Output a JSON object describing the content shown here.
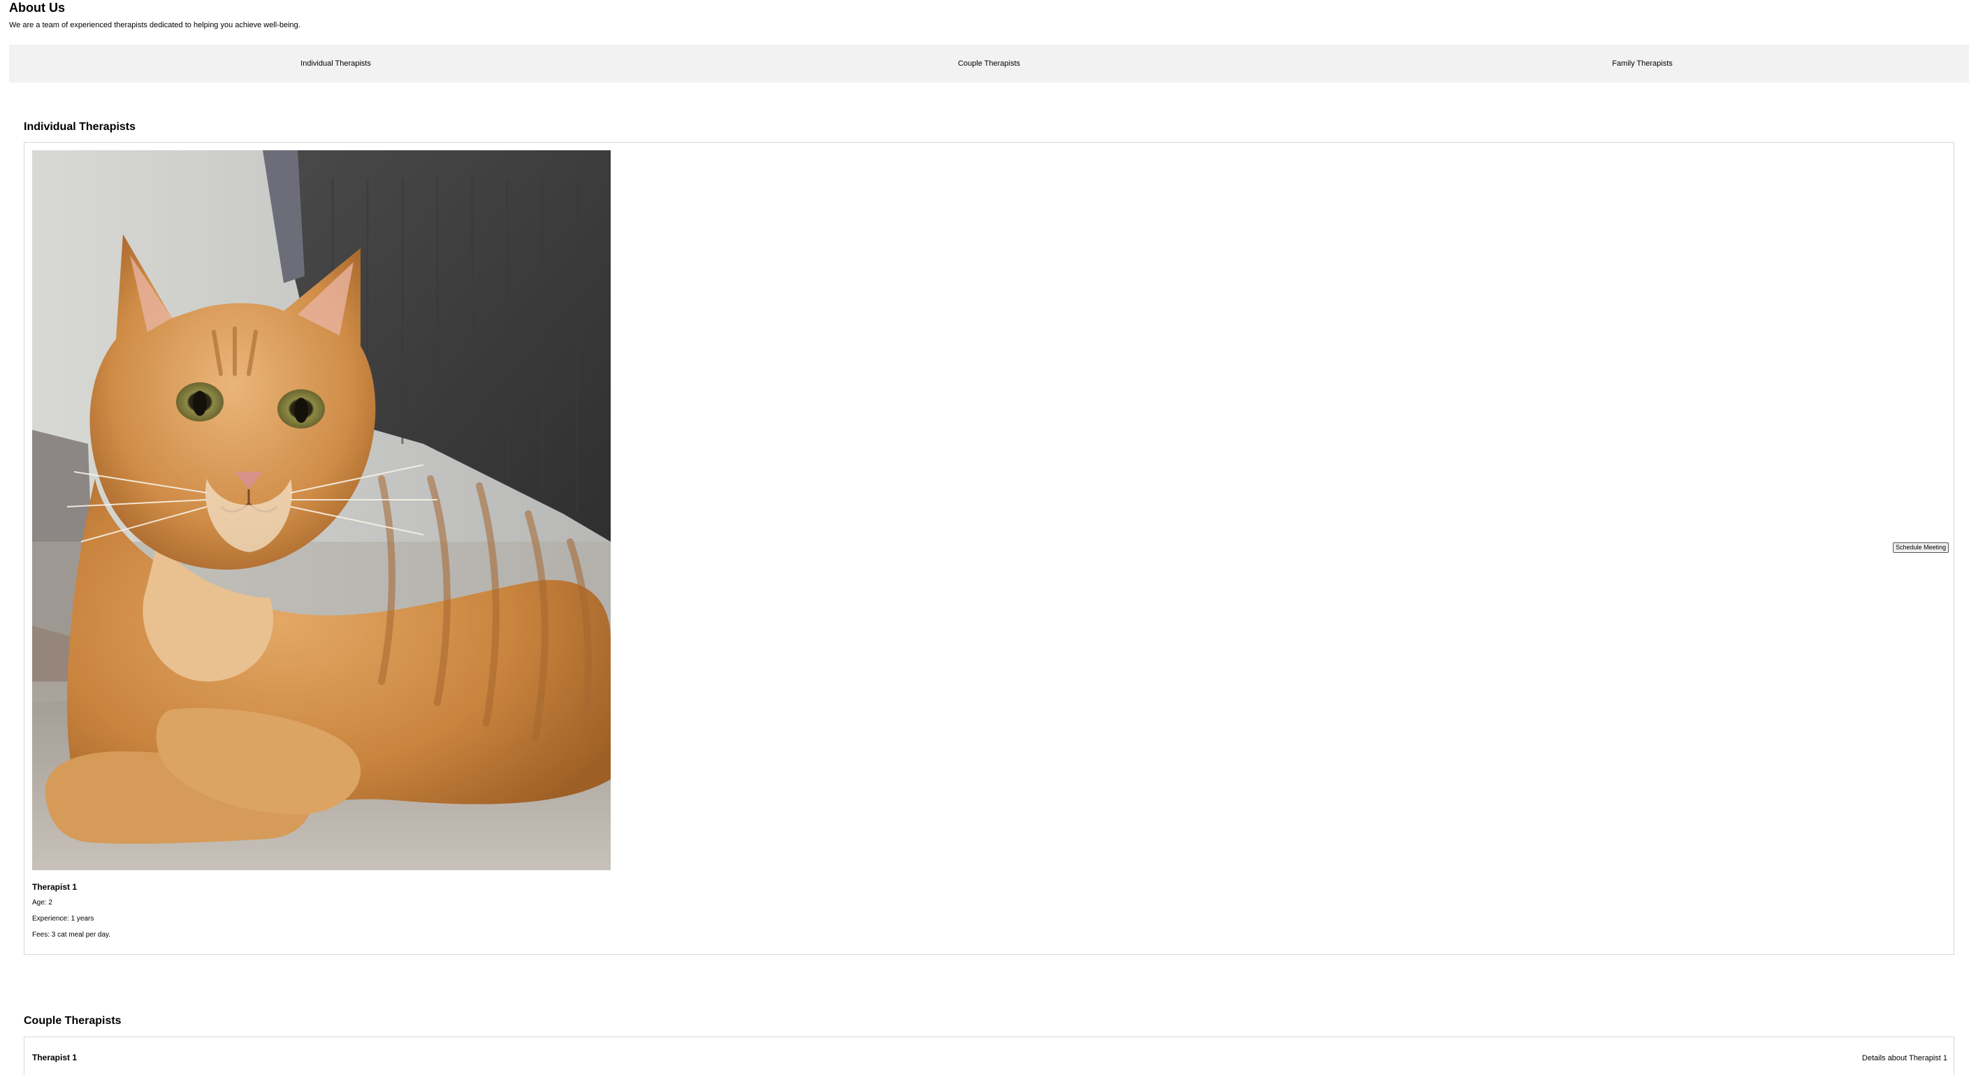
{
  "about": {
    "title": "About Us",
    "description": "We are a team of experienced therapists dedicated to helping you achieve well-being."
  },
  "nav": {
    "items": [
      {
        "label": "Individual Therapists"
      },
      {
        "label": "Couple Therapists"
      },
      {
        "label": "Family Therapists"
      }
    ]
  },
  "individual": {
    "heading": "Individual Therapists",
    "therapist": {
      "name": "Therapist 1",
      "age": "Age: 2",
      "experience": "Experience: 1 years",
      "fees": "Fees: 3 cat meal per day."
    },
    "schedule_label": "Schedule Meeting"
  },
  "couple": {
    "heading": "Couple Therapists",
    "therapist": {
      "name": "Therapist 1",
      "details": "Details about Therapist 1"
    }
  },
  "colors": {
    "nav_background": "#f2f2f2",
    "card_border": "#d9d9d9"
  }
}
